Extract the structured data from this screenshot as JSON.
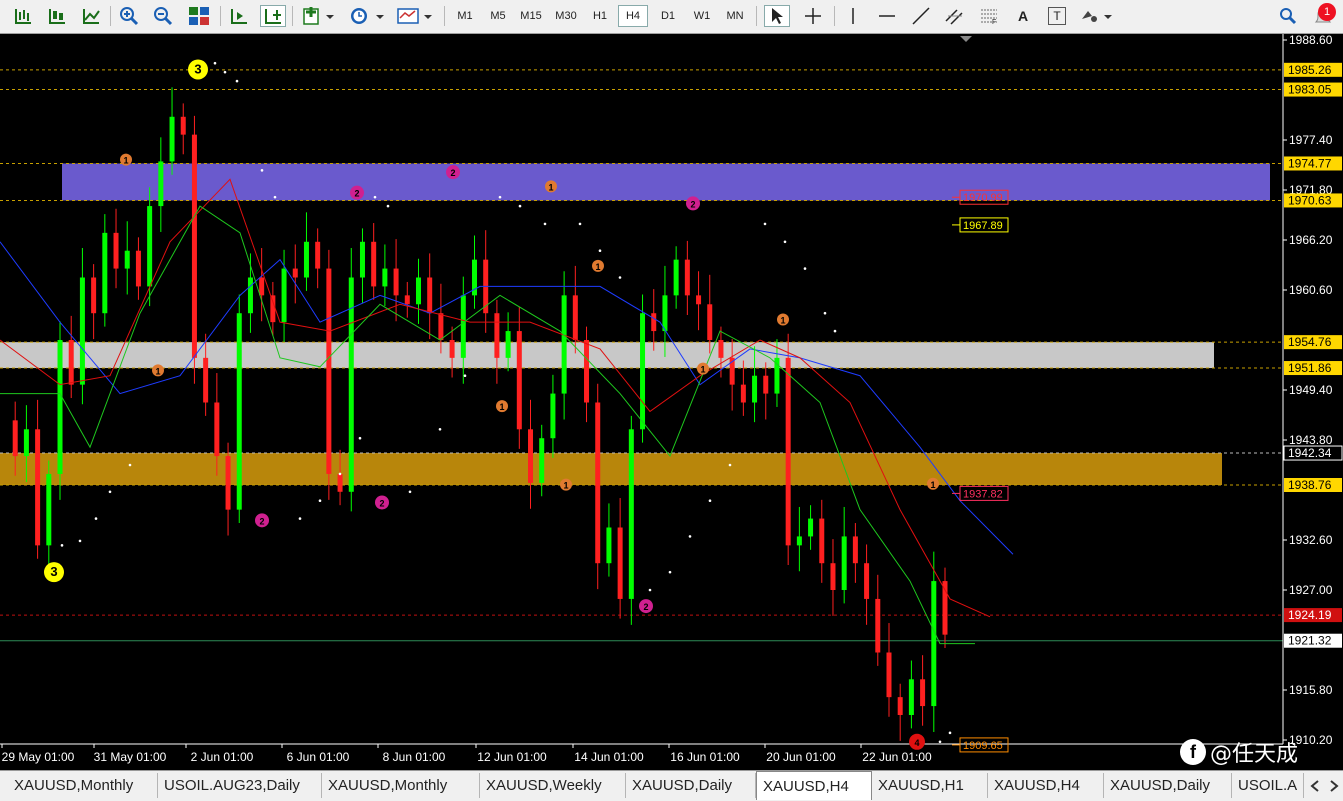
{
  "toolbar": {
    "icons": [
      "chart-bar-icon",
      "chart-candle-icon",
      "chart-line-icon",
      "zoom-in-icon",
      "zoom-out-icon",
      "tile-windows-icon",
      "autoscroll-icon",
      "chart-shift-icon",
      "new-chart-icon",
      "clock-icon",
      "templates-icon",
      "cursor-icon",
      "crosshair-icon",
      "vertical-line-icon",
      "horizontal-line-icon",
      "trendline-icon",
      "channel-icon",
      "fibonacci-icon",
      "text-icon",
      "text-label-icon",
      "shapes-icon",
      "search-icon",
      "notification-icon"
    ],
    "timeframes": [
      "M1",
      "M5",
      "M15",
      "M30",
      "H1",
      "H4",
      "D1",
      "W1",
      "MN"
    ],
    "active_timeframe": "H4",
    "text_tool": "A",
    "label_tool": "T",
    "notification_count": "1"
  },
  "price_axis": {
    "ticks": [
      "1988.60",
      "1977.40",
      "1971.80",
      "1966.20",
      "1960.60",
      "1949.40",
      "1943.80",
      "1932.60",
      "1927.00",
      "1915.80",
      "1910.20"
    ],
    "labels": [
      {
        "text": "1985.26",
        "style": "yellow"
      },
      {
        "text": "1983.05",
        "style": "yellow"
      },
      {
        "text": "1974.77",
        "style": "yellow"
      },
      {
        "text": "1970.63",
        "style": "yellow"
      },
      {
        "text": "1954.76",
        "style": "yellow"
      },
      {
        "text": "1951.86",
        "style": "yellow"
      },
      {
        "text": "1942.34",
        "style": "white"
      },
      {
        "text": "1938.76",
        "style": "yellow"
      },
      {
        "text": "1924.19",
        "style": "red"
      },
      {
        "text": "1921.32",
        "style": "bid"
      }
    ]
  },
  "time_axis": [
    "29 May 01:00",
    "31 May 01:00",
    "2 Jun 01:00",
    "6 Jun 01:00",
    "8 Jun 01:00",
    "12 Jun 01:00",
    "14 Jun 01:00",
    "16 Jun 01:00",
    "20 Jun 01:00",
    "22 Jun 01:00"
  ],
  "chart_labels": [
    {
      "text": "1970.99",
      "color": "#ff3030"
    },
    {
      "text": "1967.89",
      "color": "#ffff00"
    },
    {
      "text": "1937.82",
      "color": "#ff3060"
    },
    {
      "text": "1909.65",
      "color": "#ff8c00"
    }
  ],
  "wave_markers": {
    "yellow": [
      "3",
      "3"
    ],
    "orange": [
      "1",
      "1",
      "1",
      "1",
      "1",
      "1",
      "1",
      "1",
      "1"
    ],
    "magenta": [
      "2",
      "2",
      "2",
      "2",
      "2",
      "2",
      "2"
    ],
    "red": [
      "4"
    ]
  },
  "zones": {
    "purple_color": "#6a5acd",
    "gray_color": "#c8c8c8",
    "gold_color": "#b8860b"
  },
  "tabs": [
    "XAUUSD,Monthly",
    "USOIL.AUG23,Daily",
    "XAUUSD,Monthly",
    "XAUUSD,Weekly",
    "XAUUSD,Daily",
    "XAUUSD,H4",
    "XAUUSD,H1",
    "XAUUSD,H4",
    "XAUUSD,Daily",
    "USOIL.A"
  ],
  "active_tab": "XAUUSD,H4",
  "watermark": "@任天成",
  "watermark_logo": "f"
}
